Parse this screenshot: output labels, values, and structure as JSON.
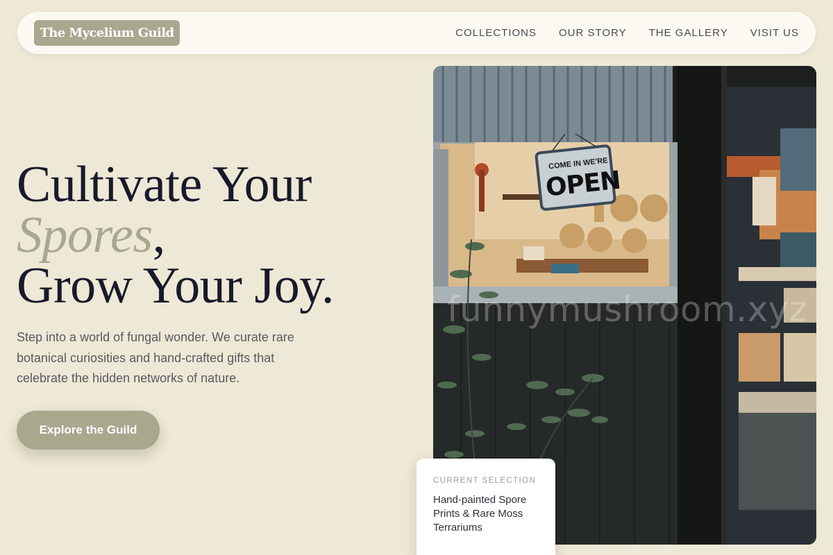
{
  "nav": {
    "logo": "The Mycelium Guild",
    "links": [
      "COLLECTIONS",
      "OUR STORY",
      "THE GALLERY",
      "VISIT US"
    ]
  },
  "hero": {
    "line1": "Cultivate Your",
    "accent": "Spores",
    "accent_punct": ",",
    "line3": "Grow Your Joy.",
    "subtitle": "Step into a world of fungal wonder. We curate rare botanical curiosities and hand-crafted gifts that celebrate the hidden networks of nature.",
    "cta": "Explore the Guild"
  },
  "photo": {
    "sign_small": "COME IN WE'RE",
    "sign_big": "OPEN",
    "watermark": "funnymushroom.xyz"
  },
  "card": {
    "label": "Current Selection",
    "text": "Hand-painted Spore Prints & Rare Moss Terrariums"
  },
  "colors": {
    "background": "#eee8d6",
    "accent": "#a8a88f",
    "heading": "#161a2a"
  }
}
